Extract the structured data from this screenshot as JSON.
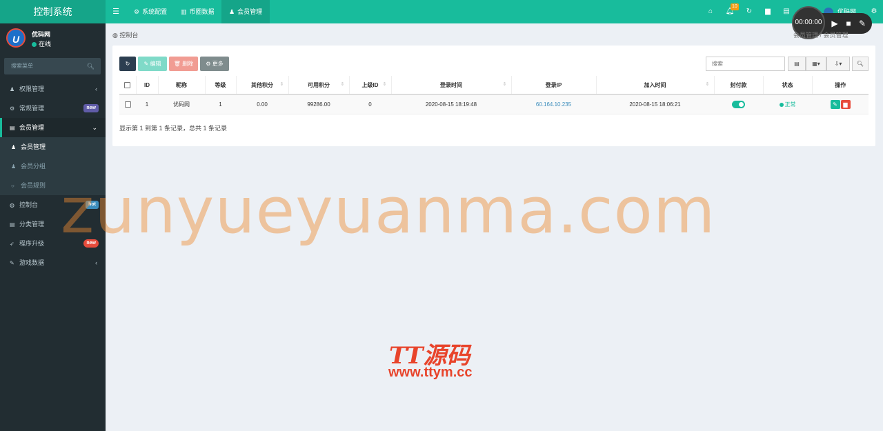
{
  "app": {
    "brand": "控制系统"
  },
  "topnav": {
    "tabs": [
      {
        "icon": "⚙",
        "label": "系统配置"
      },
      {
        "icon": "▥",
        "label": "币圈数据"
      },
      {
        "icon": "♟",
        "label": "会员管理"
      }
    ],
    "notifications_count": "10",
    "user_name": "优码网"
  },
  "recorder": {
    "time": "00:00:00"
  },
  "sidebar": {
    "user": {
      "name": "优码网",
      "status": "在线",
      "logo_letter": "U"
    },
    "search_placeholder": "搜索菜单",
    "items": [
      {
        "label": "权限管理",
        "icon": "♟"
      },
      {
        "label": "常规管理",
        "icon": "⚙",
        "badge": "new"
      },
      {
        "label": "会员管理",
        "icon": "▤"
      },
      {
        "label": "会员管理",
        "icon": "♟"
      },
      {
        "label": "会员分组",
        "icon": "♟"
      },
      {
        "label": "会员规则",
        "icon": "○"
      },
      {
        "label": "控制台",
        "icon": "◍",
        "badge": "hot"
      },
      {
        "label": "分类管理",
        "icon": "▤"
      },
      {
        "label": "程序升级",
        "icon": "➶",
        "badge": "new"
      },
      {
        "label": "游戏数据",
        "icon": "✎"
      }
    ]
  },
  "breadcrumb": {
    "left": "控制台",
    "right": "会员管理 / 会员管理"
  },
  "toolbar": {
    "refresh_icon": "↻",
    "edit": "✎ 编辑",
    "delete": "🗑 删除",
    "more": "⚙ 更多",
    "search_placeholder": "搜索"
  },
  "table": {
    "columns": [
      "ID",
      "昵称",
      "等级",
      "其他积分",
      "可用积分",
      "上级ID",
      "登录时间",
      "登录IP",
      "加入时间",
      "封付款",
      "状态",
      "操作"
    ],
    "rows": [
      {
        "id": "1",
        "nickname": "优码网",
        "level": "1",
        "other_points": "0.00",
        "available_points": "99286.00",
        "parent_id": "0",
        "login_time": "2020-08-15 18:19:48",
        "login_ip": "60.164.10.235",
        "join_time": "2020-08-15 18:06:21",
        "status": "正常"
      }
    ]
  },
  "pager_info": "显示第 1 到第 1 条记录，总共 1 条记录",
  "watermarks": {
    "main": "zunyueyuanma.com",
    "logo": "TT源码",
    "url": "www.ttym.cc"
  },
  "colors": {
    "accent": "#18bc9c",
    "sidebar_bg": "#222d32",
    "danger": "#e74c3c"
  }
}
